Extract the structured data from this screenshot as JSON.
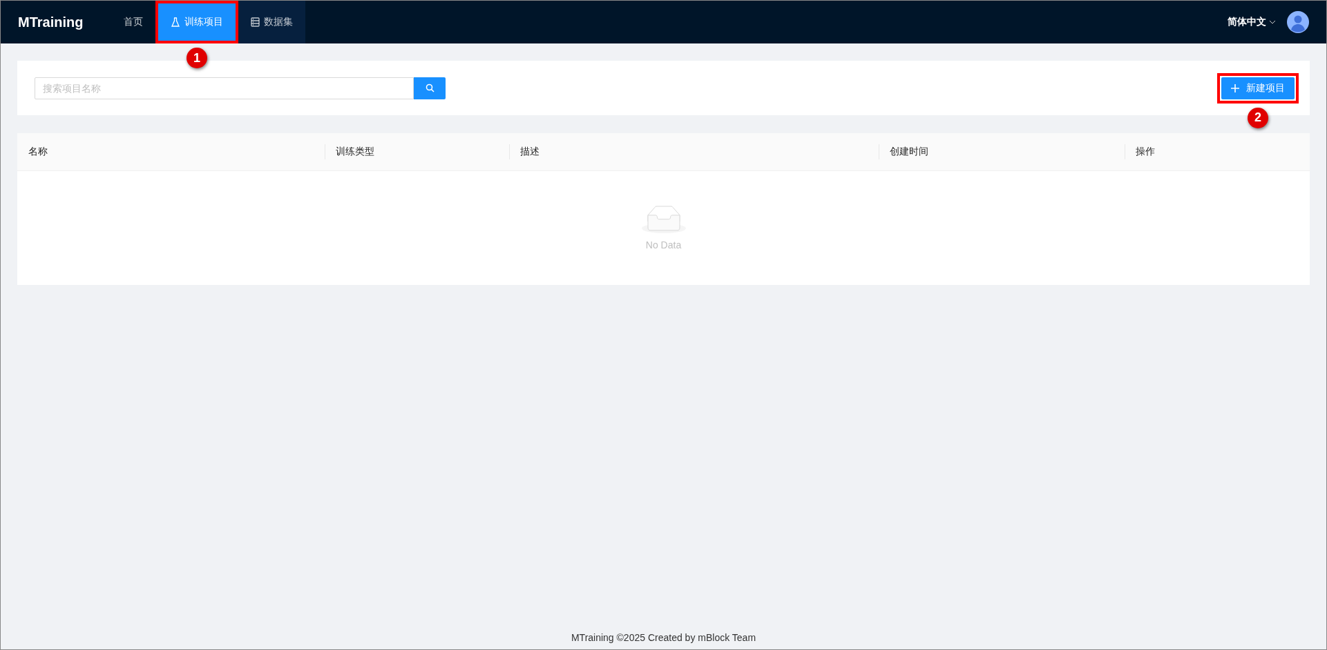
{
  "header": {
    "logo": "MTraining",
    "nav": [
      {
        "label": "首页",
        "kind": "plain",
        "selected": false,
        "highlighted": false
      },
      {
        "label": "训练项目",
        "kind": "flask",
        "selected": true,
        "highlighted": false,
        "callout": "1"
      },
      {
        "label": "数据集",
        "kind": "list",
        "selected": false,
        "highlighted": true
      }
    ],
    "language": "简体中文"
  },
  "search": {
    "placeholder": "搜索项目名称"
  },
  "new_button": {
    "label": "新建项目",
    "callout": "2"
  },
  "table": {
    "columns": [
      "名称",
      "训练类型",
      "描述",
      "创建时间",
      "操作"
    ],
    "empty_text": "No Data"
  },
  "footer": "MTraining ©2025 Created by mBlock Team"
}
